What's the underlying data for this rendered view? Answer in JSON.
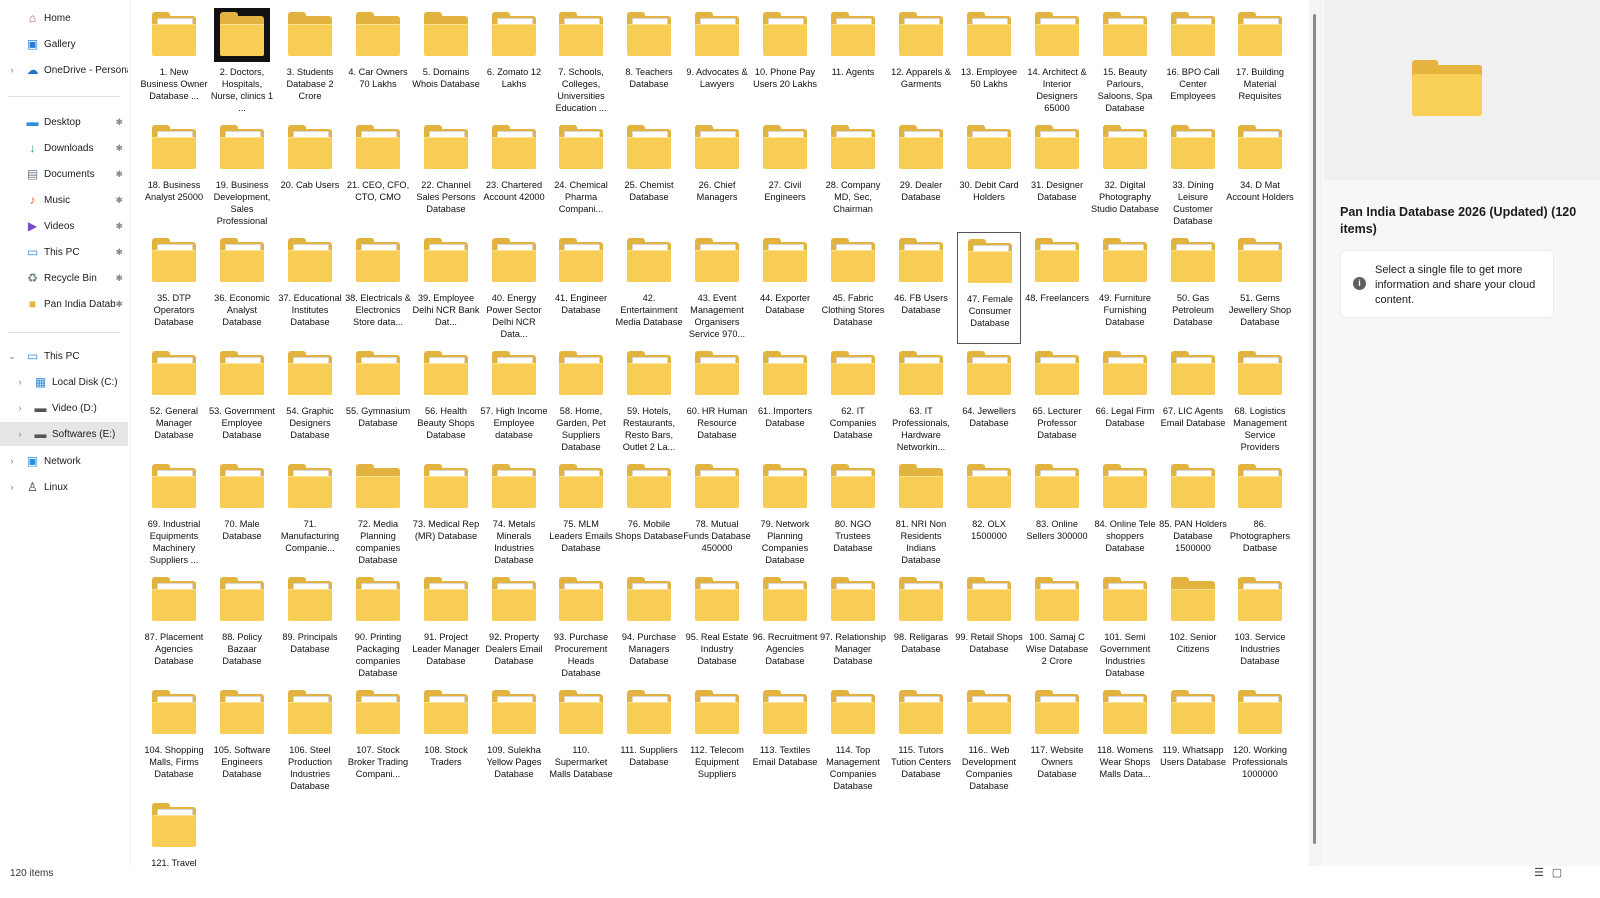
{
  "sidebar": {
    "items": [
      {
        "label": "Home",
        "icon": "home-icon",
        "glyph": "⌂",
        "color": "#c0504d",
        "pinned": false,
        "chevron": false
      },
      {
        "label": "Gallery",
        "icon": "gallery-icon",
        "glyph": "▣",
        "color": "#2b7bd6",
        "pinned": false,
        "chevron": false
      },
      {
        "label": "OneDrive - Persona",
        "icon": "onedrive-icon",
        "glyph": "☁",
        "color": "#1a73c9",
        "pinned": false,
        "chevron": true
      },
      {
        "label": "Desktop",
        "icon": "desktop-icon",
        "glyph": "▬",
        "color": "#2f8ed8",
        "pinned": true,
        "chevron": false
      },
      {
        "label": "Downloads",
        "icon": "downloads-icon",
        "glyph": "↓",
        "color": "#2a9d6b",
        "pinned": true,
        "chevron": false
      },
      {
        "label": "Documents",
        "icon": "documents-icon",
        "glyph": "▤",
        "color": "#6b7b8c",
        "pinned": true,
        "chevron": false
      },
      {
        "label": "Music",
        "icon": "music-icon",
        "glyph": "♪",
        "color": "#e0603b",
        "pinned": true,
        "chevron": false
      },
      {
        "label": "Videos",
        "icon": "videos-icon",
        "glyph": "▶",
        "color": "#7a4bc8",
        "pinned": true,
        "chevron": false
      },
      {
        "label": "This PC",
        "icon": "this-pc-icon",
        "glyph": "▭",
        "color": "#2f8ed8",
        "pinned": true,
        "chevron": false
      },
      {
        "label": "Recycle Bin",
        "icon": "recycle-bin-icon",
        "glyph": "♻",
        "color": "#6b7b8c",
        "pinned": true,
        "chevron": false
      },
      {
        "label": "Pan India Datab",
        "icon": "folder-icon",
        "glyph": "■",
        "color": "#e8b63c",
        "pinned": true,
        "chevron": false
      },
      {
        "label": "This PC",
        "icon": "this-pc-icon",
        "glyph": "▭",
        "color": "#2f8ed8",
        "pinned": false,
        "chevron": "open"
      },
      {
        "label": "Local Disk (C:)",
        "icon": "windows-drive-icon",
        "glyph": "▦",
        "color": "#2f8ed8",
        "pinned": false,
        "chevron": true,
        "indent": true
      },
      {
        "label": "Video (D:)",
        "icon": "drive-icon",
        "glyph": "▬",
        "color": "#555555",
        "pinned": false,
        "chevron": true,
        "indent": true
      },
      {
        "label": "Softwares (E:)",
        "icon": "drive-icon",
        "glyph": "▬",
        "color": "#555555",
        "pinned": false,
        "chevron": true,
        "indent": true,
        "selected": true
      },
      {
        "label": "Network",
        "icon": "network-icon",
        "glyph": "▣",
        "color": "#2f8ed8",
        "pinned": false,
        "chevron": true
      },
      {
        "label": "Linux",
        "icon": "linux-icon",
        "glyph": "♙",
        "color": "#333333",
        "pinned": false,
        "chevron": true
      }
    ]
  },
  "files": [
    "1. New Business Owner Database ...",
    "2. Doctors, Hospitals, Nurse, clinics 1 ...",
    "3. Students Database 2 Crore",
    "4. Car Owners 70 Lakhs",
    "5. Domains Whois Database",
    "6. Zomato 12 Lakhs",
    "7. Schools, Colleges, Universities Education ...",
    "8. Teachers Database",
    "9. Advocates & Lawyers",
    "10. Phone Pay Users 20 Lakhs",
    "11. Agents",
    "12. Apparels & Garments",
    "13. Employee 50 Lakhs",
    "14. Architect & Interior Designers 65000",
    "15. Beauty Parlours, Saloons, Spa Database",
    "16. BPO Call Center Employees",
    "17. Building Material Requisites",
    "18. Business Analyst 25000",
    "19. Business Development, Sales Professional",
    "20. Cab Users",
    "21. CEO, CFO, CTO, CMO",
    "22. Channel Sales Persons Database",
    "23. Chartered Account 42000",
    "24. Chemical Pharma Compani...",
    "25. Chemist Database",
    "26. Chief Managers",
    "27. Civil Engineers",
    "28. Company MD, Sec, Chairman",
    "29. Dealer Database",
    "30. Debit Card Holders",
    "31. Designer Database",
    "32. Digital Photography Studio Database",
    "33. Dining Leisure Customer Database",
    "34. D Mat Account Holders",
    "35. DTP Operators Database",
    "36. Economic Analyst Database",
    "37. Educational Institutes Database",
    "38. Electricals & Electronics Store data...",
    "39. Employee Delhi NCR Bank Dat...",
    "40. Energy Power Sector Delhi NCR Data...",
    "41. Engineer Database",
    "42. Entertainment Media Database",
    "43. Event Management Organisers Service 970...",
    "44. Exporter Database",
    "45. Fabric Clothing Stores Database",
    "46. FB Users Database",
    "47. Female Consumer Database",
    "48. Freelancers",
    "49. Furniture Furnishing Database",
    "50. Gas Petroleum Database",
    "51. Gems Jewellery Shop Database",
    "52. General Manager Database",
    "53. Government Employee Database",
    "54. Graphic Designers Database",
    "55. Gymnasium Database",
    "56. Health Beauty Shops Database",
    "57. High Income Employee database",
    "58. Home, Garden, Pet Suppliers Database",
    "59. Hotels, Restaurants, Resto Bars, Outlet 2 La...",
    "60. HR Human Resource Database",
    "61. Importers Database",
    "62. IT Companies Database",
    "63.  IT Professionals, Hardware Networkin...",
    "64. Jewellers Database",
    "65. Lecturer Professor Database",
    "66. Legal Firm Database",
    "67. LIC Agents Email Database",
    "68. Logistics Management Service Providers",
    "69. Industrial Equipments Machinery Suppliers ...",
    "70. Male Database",
    "71. Manufacturing Companie...",
    "72. Media Planning companies Database",
    "73. Medical Rep (MR) Database",
    "74. Metals Minerals Industries Database",
    "75. MLM Leaders Emails Database",
    "76. Mobile Shops Database",
    "78. Mutual Funds Database 450000",
    "79. Network Planning Companies Database",
    "80. NGO Trustees Database",
    "81. NRI  Non Residents Indians Database",
    "82. OLX 1500000",
    "83. Online Sellers 300000",
    "84. Online Tele shoppers Database",
    "85. PAN Holders Database 1500000",
    "86. Photographers Datbase",
    "87. Placement Agencies Database",
    "88. Policy Bazaar Database",
    "89. Principals Database",
    "90. Printing Packaging companies Database",
    "91. Project Leader Manager Database",
    "92. Property Dealers Email Database",
    "93. Purchase Procurement Heads Database",
    "94. Purchase Managers Database",
    "95. Real Estate Industry Database",
    "96. Recruitment Agencies Database",
    "97. Relationship Manager Database",
    "98. Religaras Database",
    "99. Retail Shops Database",
    "100. Samaj C Wise Database 2 Crore",
    "101. Semi Government Industries Database",
    "102. Senior Citizens",
    "103. Service Industries Database",
    "104. Shopping Malls, Firms Database",
    "105. Software Engineers Database",
    "106. Steel Production Industries Database",
    "107. Stock Broker Trading Compani...",
    "108. Stock Traders",
    "109. Sulekha Yellow Pages Database",
    "110. Supermarket Malls Database",
    "111. Suppliers Database",
    "112. Telecom Equipment Suppliers",
    "113. Textiles Email Database",
    "114. Top Management Companies Database",
    "115. Tutors Tution Centers Database",
    "116.. Web Development Companies Database",
    "117. Website Owners Database",
    "118. Womens Wear Shops Malls Data...",
    "119. Whatsapp Users Database",
    "120. Working Professionals 1000000",
    "121. Travel"
  ],
  "tile_states": {
    "dark_highlight": [
      1
    ],
    "bordered": [
      46
    ],
    "plain_folder": [
      1,
      2,
      3,
      4,
      71,
      79,
      100
    ],
    "excel_badge": [
      10,
      13,
      20
    ]
  },
  "details": {
    "title": "Pan India Database 2026 (Updated) (120 items)",
    "info_text": "Select a single file to get more information and share your cloud content.",
    "info_glyph": "i"
  },
  "status": {
    "items_count": "120 items",
    "details_view_glyph": "☰",
    "tiles_view_glyph": "▢"
  },
  "colors": {
    "folder_front": "#f7cd55",
    "folder_back": "#e2b33e",
    "excel_green": "#1f9d55",
    "selection": "#e6e6e6"
  }
}
